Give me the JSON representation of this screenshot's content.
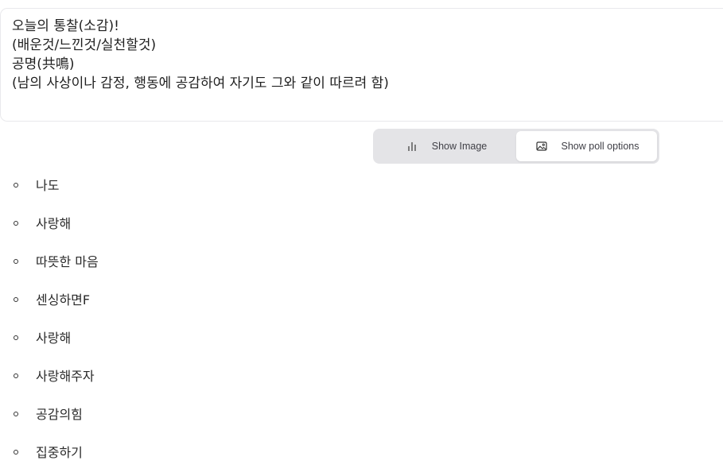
{
  "prompt": {
    "lines": [
      "오늘의 통찰(소감)!",
      "(배운것/느낀것/실천할것)",
      "공명(共鳴)",
      "(남의 사상이나 감정, 행동에 공감하여 자기도 그와 같이 따르려 함)"
    ]
  },
  "toggle": {
    "show_image_label": "Show Image",
    "show_image_icon": "bar-chart-icon",
    "show_poll_label": "Show poll options",
    "show_poll_icon": "image-icon",
    "active": "show_poll_options"
  },
  "options": [
    "나도",
    "사랑해",
    "따뜻한 마음",
    "센싱하면F",
    "사랑해",
    "사랑해주자",
    "공감의힘",
    "집중하기"
  ]
}
